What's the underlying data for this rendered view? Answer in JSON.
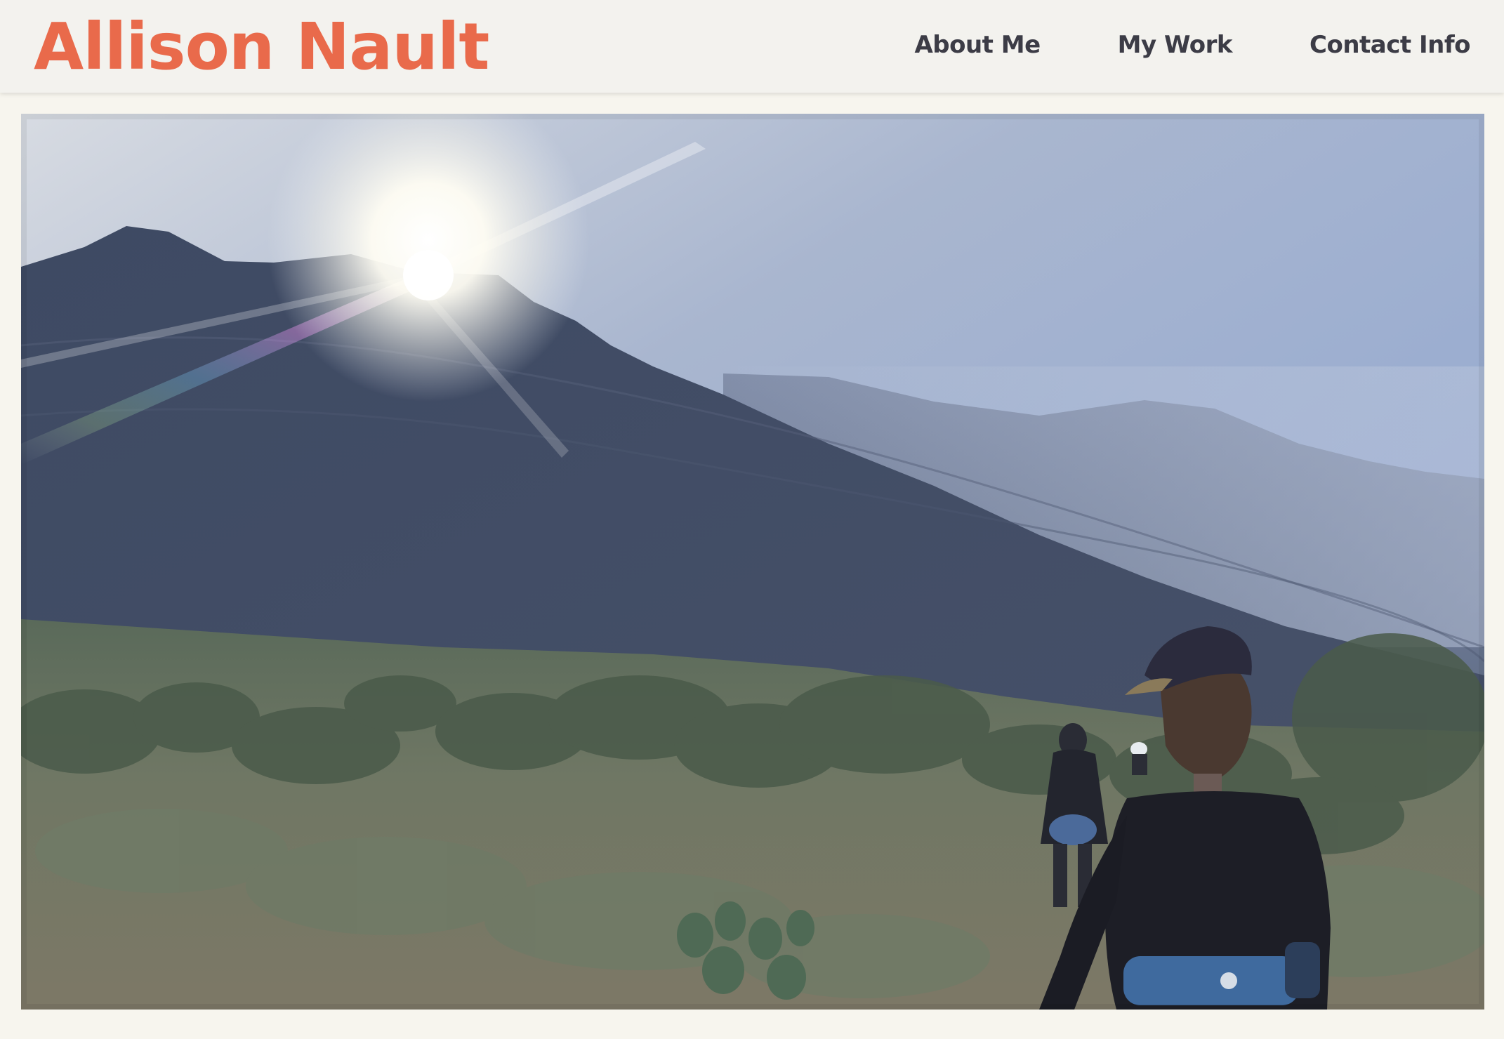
{
  "header": {
    "site_title": "Allison Nault",
    "nav": [
      {
        "label": "About Me"
      },
      {
        "label": "My Work"
      },
      {
        "label": "Contact Info"
      }
    ]
  },
  "colors": {
    "brand": "#e96a4b",
    "nav_text": "#3c3c46",
    "header_bg": "#f3f2ee",
    "page_bg": "#f7f5ee"
  },
  "hero": {
    "image_subject": "hikers-walking-toward-mountain-at-sunrise"
  }
}
